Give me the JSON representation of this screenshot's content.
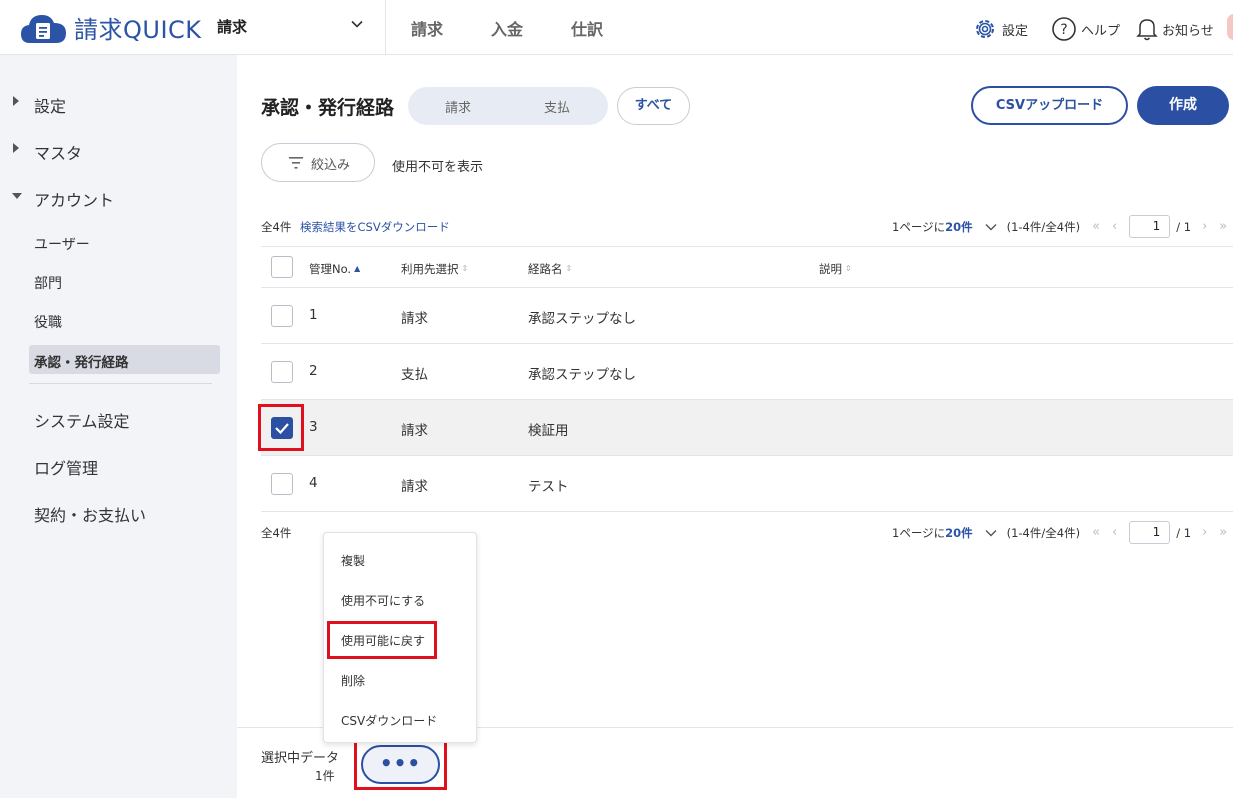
{
  "header": {
    "logo_text": "請求QUICK",
    "app_select": "請求",
    "nav": [
      "請求",
      "入金",
      "仕訳"
    ],
    "settings": "設定",
    "help": "ヘルプ",
    "notifications": "お知らせ"
  },
  "sidebar": {
    "top": [
      "設定",
      "マスタ",
      "アカウント"
    ],
    "account_items": [
      "ユーザー",
      "部門",
      "役職",
      "承認・発行経路"
    ],
    "active_item": "承認・発行経路",
    "bottom": [
      "システム設定",
      "ログ管理",
      "契約・お支払い"
    ]
  },
  "main": {
    "title": "承認・発行経路",
    "segments": [
      "請求",
      "支払"
    ],
    "all_button": "すべて",
    "csv_upload": "CSVアップロード",
    "create": "作成",
    "filter": "絞込み",
    "show_disabled": "使用不可を表示",
    "total": "全4件",
    "csv_download_link": "検索結果をCSVダウンロード",
    "pager": {
      "per_page_prefix": "1ページに",
      "per_page": "20件",
      "range": "(1-4件/全4件)",
      "page": "1",
      "pages": "/ 1"
    },
    "table": {
      "headers": [
        "管理No.",
        "利用先選択",
        "経路名",
        "説明"
      ],
      "rows": [
        {
          "no": "1",
          "usage": "請求",
          "name": "承認ステップなし",
          "desc": "",
          "checked": false
        },
        {
          "no": "2",
          "usage": "支払",
          "name": "承認ステップなし",
          "desc": "",
          "checked": false
        },
        {
          "no": "3",
          "usage": "請求",
          "name": "検証用",
          "desc": "",
          "checked": true
        },
        {
          "no": "4",
          "usage": "請求",
          "name": "テスト",
          "desc": "",
          "checked": false
        }
      ]
    },
    "bottom_total": "全4件"
  },
  "context_menu": {
    "items": [
      "複製",
      "使用不可にする",
      "使用可能に戻す",
      "削除",
      "CSVダウンロード"
    ]
  },
  "bottom_bar": {
    "selected_label": "選択中データ",
    "selected_count": "1件",
    "more_button": "•••"
  },
  "colors": {
    "brand": "#2b4fa2",
    "highlight": "#e0101e",
    "sidebar_bg": "#f3f4f8"
  }
}
